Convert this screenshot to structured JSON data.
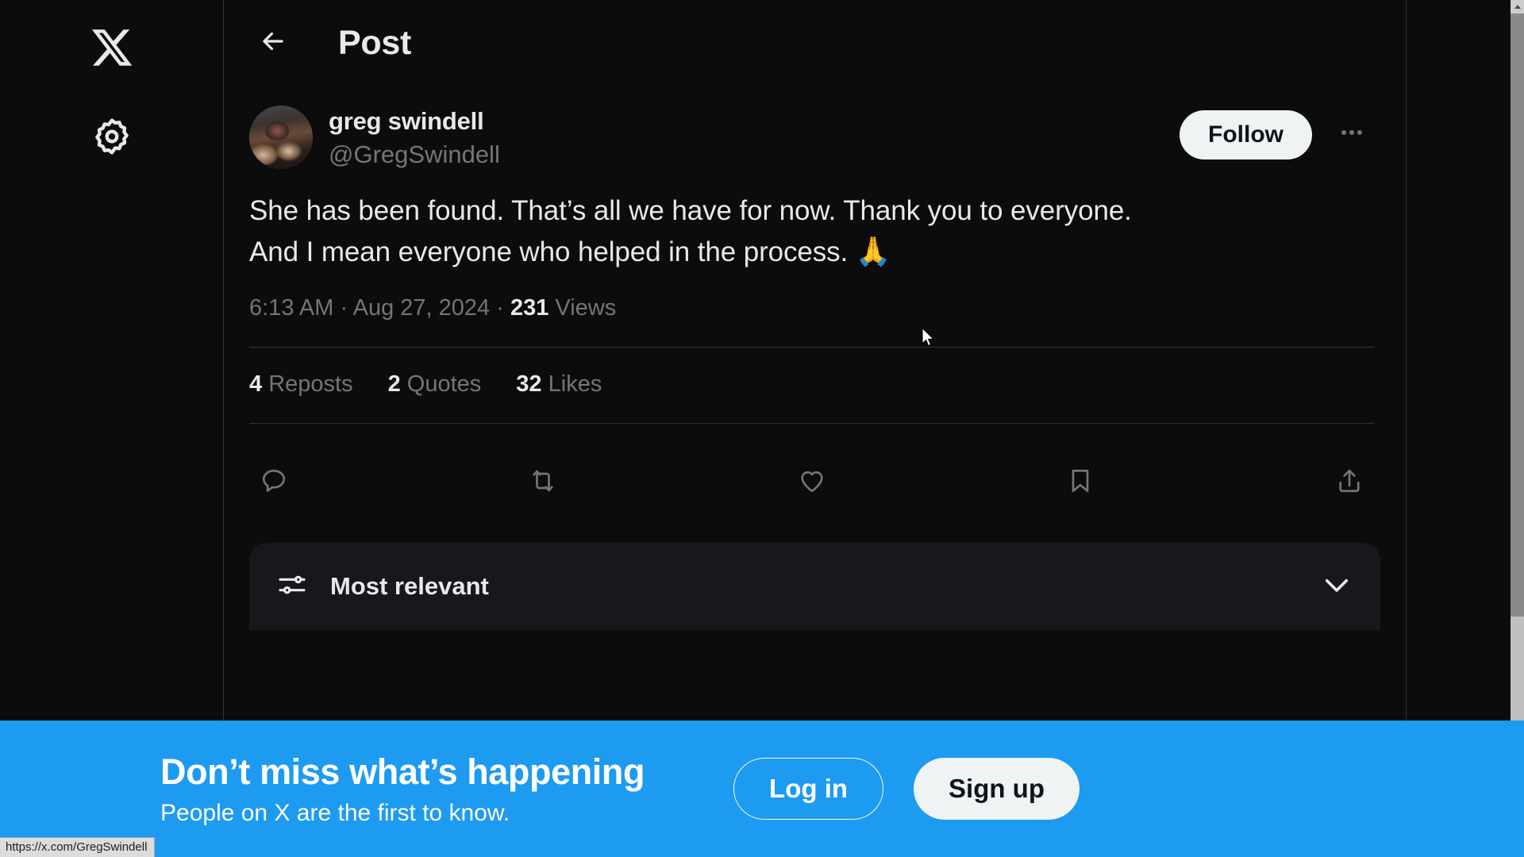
{
  "window": {
    "background_color": "#0c0c0c",
    "accent_color": "#1d9bf0",
    "status_url": "https://x.com/GregSwindell"
  },
  "sidebar": {
    "items": [
      {
        "name": "x-logo",
        "icon": "x-logo-icon",
        "label": "X"
      },
      {
        "name": "settings",
        "icon": "gear-icon",
        "label": "Settings"
      }
    ]
  },
  "header": {
    "back_label": "Back",
    "title": "Post"
  },
  "post": {
    "author": {
      "display_name": "greg swindell",
      "handle": "@GregSwindell",
      "avatar_alt": "greg swindell profile photo"
    },
    "follow_label": "Follow",
    "more_label": "More",
    "text_line_1": "She has been found. That’s all we have for now. Thank you to everyone.",
    "text_line_2": "And I mean everyone who helped in the process.",
    "emoji": "🙏",
    "meta": {
      "time": "6:13 AM",
      "separator": "·",
      "date": "Aug 27, 2024",
      "views_count": "231",
      "views_label": "Views"
    },
    "stats": [
      {
        "count": "4",
        "label": "Reposts"
      },
      {
        "count": "2",
        "label": "Quotes"
      },
      {
        "count": "32",
        "label": "Likes"
      }
    ],
    "actions": [
      {
        "name": "reply",
        "icon": "reply-icon",
        "label": "Reply"
      },
      {
        "name": "repost",
        "icon": "repost-icon",
        "label": "Repost"
      },
      {
        "name": "like",
        "icon": "heart-icon",
        "label": "Like"
      },
      {
        "name": "bookmark",
        "icon": "bookmark-icon",
        "label": "Bookmark"
      },
      {
        "name": "share",
        "icon": "share-icon",
        "label": "Share"
      }
    ]
  },
  "replies": {
    "sort_icon": "sliders-icon",
    "sort_label": "Most relevant",
    "chevron_icon": "chevron-down-icon"
  },
  "cta": {
    "title": "Don’t miss what’s happening",
    "subtitle": "People on X are the first to know.",
    "login_label": "Log in",
    "signup_label": "Sign up"
  }
}
